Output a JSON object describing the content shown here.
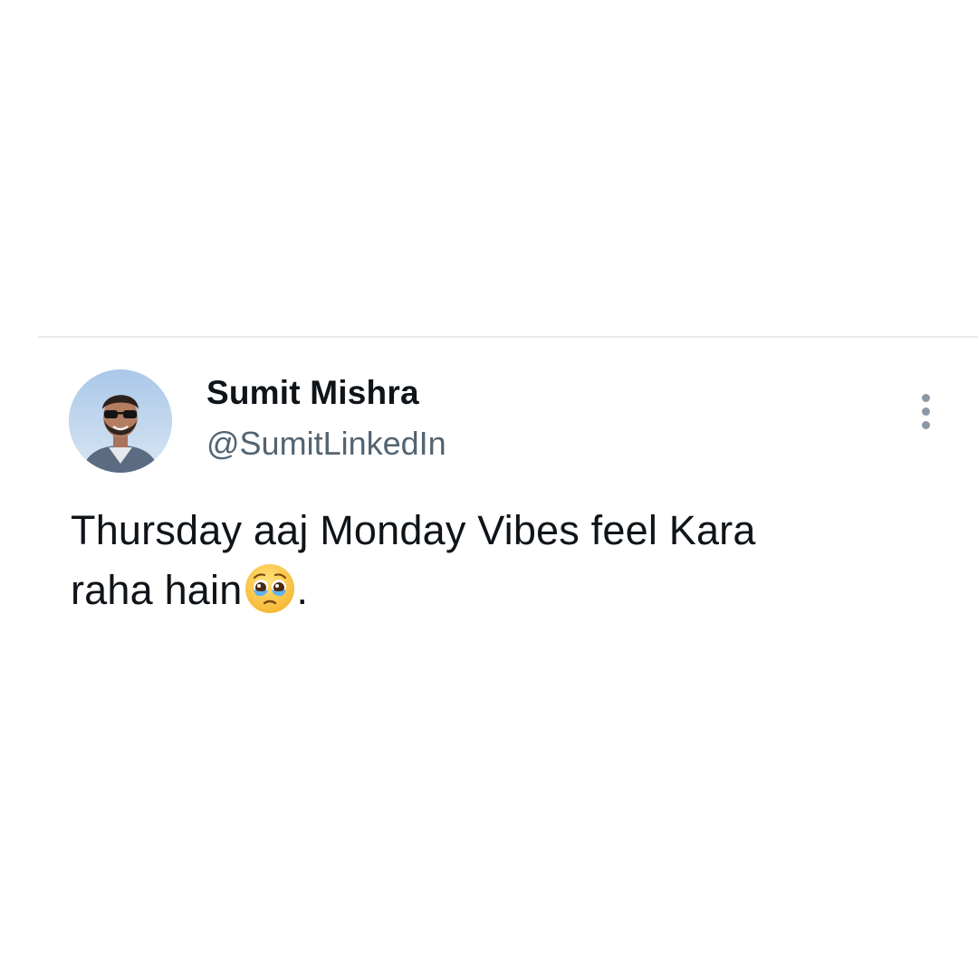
{
  "tweet": {
    "author": {
      "display_name": "Sumit Mishra",
      "handle": "@SumitLinkedIn",
      "avatar_icon": "profile-photo"
    },
    "text_line1": "Thursday aaj Monday Vibes feel Kara",
    "text_line2": "raha hain",
    "text_end": ".",
    "emoji": "pleading-face-with-tears",
    "more_icon": "vertical-ellipsis-icon"
  },
  "colors": {
    "background": "#ffffff",
    "text_primary": "#0f1419",
    "text_secondary": "#536471",
    "divider": "#e7e9ea"
  }
}
